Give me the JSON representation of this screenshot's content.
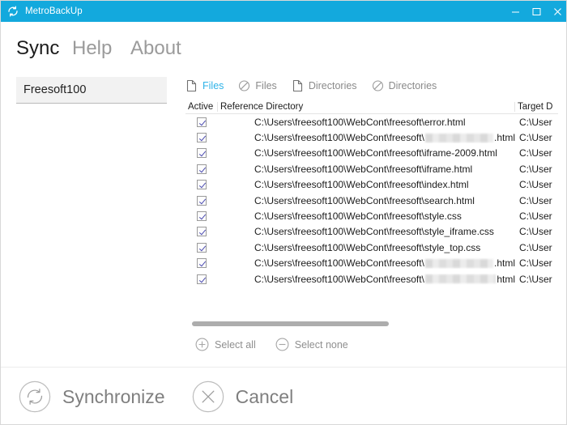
{
  "window": {
    "title": "MetroBackUp",
    "app_icon": "sync-circle-icon",
    "controls": [
      {
        "name": "minimize",
        "glyph": "minimize-icon"
      },
      {
        "name": "maximize",
        "glyph": "maximize-icon"
      },
      {
        "name": "close",
        "glyph": "close-icon"
      }
    ],
    "accent_color": "#13a9dd"
  },
  "nav": {
    "tabs": [
      {
        "label": "Sync",
        "active": true
      },
      {
        "label": "Help",
        "active": false
      },
      {
        "label": "About",
        "active": false
      }
    ]
  },
  "profile": {
    "input_value": "Freesoft100",
    "input_placeholder": "Freesoft100"
  },
  "filters": {
    "accent_color": "#2eb3e8",
    "items": [
      {
        "icon": "file-include-icon",
        "label": "Files",
        "selected": true
      },
      {
        "icon": "file-exclude-icon",
        "label": "Files",
        "selected": false
      },
      {
        "icon": "directory-include-icon",
        "label": "Directories",
        "selected": false
      },
      {
        "icon": "directory-exclude-icon",
        "label": "Directories",
        "selected": false
      }
    ]
  },
  "list": {
    "columns": [
      "Active",
      "Reference Directory",
      "Target D"
    ],
    "rows": [
      {
        "active": true,
        "reference_prefix": "C:\\Users\\freesoft100\\WebCont\\freesoft\\",
        "reference_name": "error.html",
        "redacted": false,
        "redact_width": 0,
        "reference_suffix": "",
        "target": "C:\\User"
      },
      {
        "active": true,
        "reference_prefix": "C:\\Users\\freesoft100\\WebCont\\freesoft\\",
        "reference_name": "",
        "redacted": true,
        "redact_width": 148,
        "reference_suffix": ".html",
        "target": "C:\\User"
      },
      {
        "active": true,
        "reference_prefix": "C:\\Users\\freesoft100\\WebCont\\freesoft\\",
        "reference_name": "iframe-2009.html",
        "redacted": false,
        "redact_width": 0,
        "reference_suffix": "",
        "target": "C:\\User"
      },
      {
        "active": true,
        "reference_prefix": "C:\\Users\\freesoft100\\WebCont\\freesoft\\",
        "reference_name": "iframe.html",
        "redacted": false,
        "redact_width": 0,
        "reference_suffix": "",
        "target": "C:\\User"
      },
      {
        "active": true,
        "reference_prefix": "C:\\Users\\freesoft100\\WebCont\\freesoft\\",
        "reference_name": "index.html",
        "redacted": false,
        "redact_width": 0,
        "reference_suffix": "",
        "target": "C:\\User"
      },
      {
        "active": true,
        "reference_prefix": "C:\\Users\\freesoft100\\WebCont\\freesoft\\",
        "reference_name": "search.html",
        "redacted": false,
        "redact_width": 0,
        "reference_suffix": "",
        "target": "C:\\User"
      },
      {
        "active": true,
        "reference_prefix": "C:\\Users\\freesoft100\\WebCont\\freesoft\\",
        "reference_name": "style.css",
        "redacted": false,
        "redact_width": 0,
        "reference_suffix": "",
        "target": "C:\\User"
      },
      {
        "active": true,
        "reference_prefix": "C:\\Users\\freesoft100\\WebCont\\freesoft\\",
        "reference_name": "style_iframe.css",
        "redacted": false,
        "redact_width": 0,
        "reference_suffix": "",
        "target": "C:\\User"
      },
      {
        "active": true,
        "reference_prefix": "C:\\Users\\freesoft100\\WebCont\\freesoft\\",
        "reference_name": "style_top.css",
        "redacted": false,
        "redact_width": 0,
        "reference_suffix": "",
        "target": "C:\\User"
      },
      {
        "active": true,
        "reference_prefix": "C:\\Users\\freesoft100\\WebCont\\freesoft\\",
        "reference_name": "",
        "redacted": true,
        "redact_width": 140,
        "reference_suffix": ".html",
        "target": "C:\\User"
      },
      {
        "active": true,
        "reference_prefix": "C:\\Users\\freesoft100\\WebCont\\freesoft\\",
        "reference_name": "",
        "redacted": true,
        "redact_width": 145,
        "reference_suffix": "html",
        "target": "C:\\User"
      }
    ]
  },
  "scrollbar": {
    "orientation": "horizontal",
    "thumb_fraction": 0.54
  },
  "select_actions": [
    {
      "icon": "plus-circle-icon",
      "label": "Select all"
    },
    {
      "icon": "minus-circle-icon",
      "label": "Select none"
    }
  ],
  "bottom_actions": [
    {
      "icon": "sync-circle-icon",
      "label": "Synchronize"
    },
    {
      "icon": "close-circle-icon",
      "label": "Cancel"
    }
  ]
}
